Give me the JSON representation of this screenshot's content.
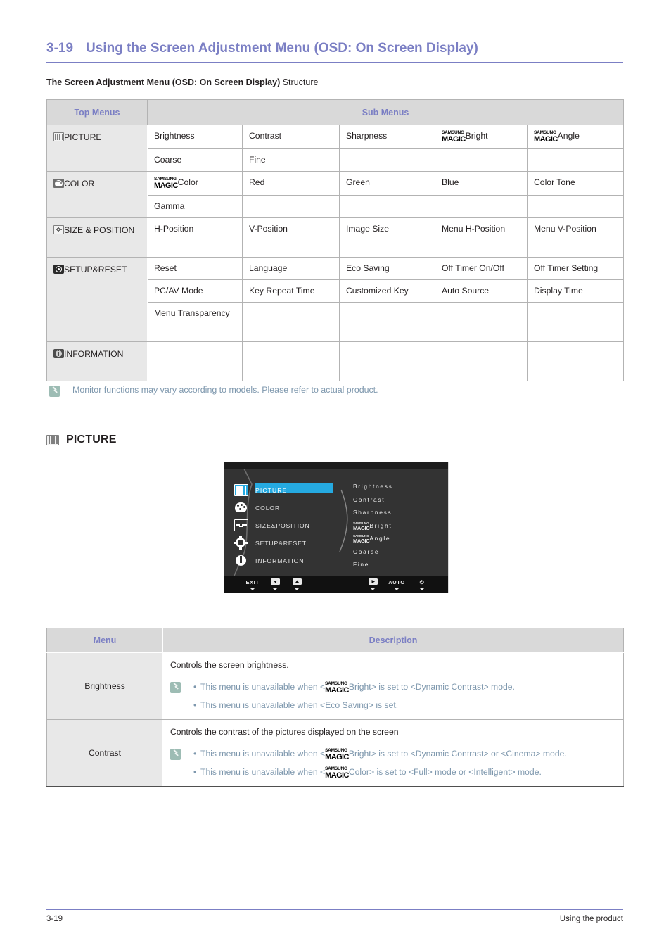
{
  "header": {
    "section_number": "3-19",
    "title": "Using the Screen Adjustment Menu (OSD: On Screen Display)",
    "accent_color": "#7b7fc4"
  },
  "subtitle": {
    "bold": "The Screen Adjustment Menu (OSD: On Screen Display)",
    "plain": " Structure"
  },
  "structure_table": {
    "headers": {
      "top_menus": "Top Menus",
      "sub_menus": "Sub Menus"
    },
    "rows": [
      {
        "top_label": "PICTURE",
        "icon": "picture-icon",
        "sub_rows": [
          [
            "Brightness",
            "Contrast",
            "Sharpness",
            "MAGIC:Bright",
            "MAGIC:Angle"
          ],
          [
            "Coarse",
            "Fine",
            "",
            "",
            ""
          ]
        ]
      },
      {
        "top_label": "COLOR",
        "icon": "color-palette-icon",
        "sub_rows": [
          [
            "MAGIC:Color",
            "Red",
            "Green",
            "Blue",
            "Color Tone"
          ],
          [
            "Gamma",
            "",
            "",
            "",
            ""
          ]
        ]
      },
      {
        "top_label": "SIZE & POSITION",
        "icon": "size-position-icon",
        "sub_rows": [
          [
            "H-Position",
            "V-Position",
            "Image Size",
            "Menu H-Position",
            "Menu V-Position"
          ]
        ]
      },
      {
        "top_label": "SETUP&RESET",
        "icon": "setup-reset-icon",
        "sub_rows": [
          [
            "Reset",
            "Language",
            "Eco Saving",
            "Off Timer On/Off",
            "Off Timer Setting"
          ],
          [
            "PC/AV Mode",
            "Key Repeat Time",
            "Customized Key",
            "Auto Source",
            "Display Time"
          ],
          [
            "Menu Transparency",
            "",
            "",
            "",
            ""
          ]
        ]
      },
      {
        "top_label": "INFORMATION",
        "icon": "information-icon",
        "sub_rows": [
          [
            "",
            "",
            "",
            "",
            ""
          ]
        ]
      }
    ]
  },
  "structure_note": "Monitor functions may vary according to models. Please refer to actual product.",
  "picture_section": {
    "heading": "PICTURE",
    "icon": "picture-icon"
  },
  "osd": {
    "left_menu": [
      {
        "label": "PICTURE",
        "icon": "picture-icon",
        "selected": true
      },
      {
        "label": "COLOR",
        "icon": "color-palette-icon",
        "selected": false
      },
      {
        "label": "SIZE&POSITION",
        "icon": "size-position-icon",
        "selected": false
      },
      {
        "label": "SETUP&RESET",
        "icon": "setup-reset-icon",
        "selected": false
      },
      {
        "label": "INFORMATION",
        "icon": "information-icon",
        "selected": false
      }
    ],
    "sub_menu": [
      {
        "label": "Brightness",
        "magic": false
      },
      {
        "label": "Contrast",
        "magic": false
      },
      {
        "label": "Sharpness",
        "magic": false
      },
      {
        "label": "Bright",
        "magic": true
      },
      {
        "label": "Angle",
        "magic": true
      },
      {
        "label": "Coarse",
        "magic": false
      },
      {
        "label": "Fine",
        "magic": false
      }
    ],
    "buttons": [
      {
        "label": "EXIT",
        "type": "text",
        "name": "exit-button"
      },
      {
        "label": "",
        "type": "down-box",
        "name": "down-button"
      },
      {
        "label": "",
        "type": "up-box",
        "name": "up-button"
      },
      {
        "label": "",
        "type": "enter-box",
        "name": "enter-button"
      },
      {
        "label": "AUTO",
        "type": "text",
        "name": "auto-button"
      },
      {
        "label": "⏻",
        "type": "power",
        "name": "power-button"
      }
    ],
    "highlight_color": "#25aae1"
  },
  "magic_logo": {
    "line1": "SAMSUNG",
    "line2": "MAGIC"
  },
  "description_table": {
    "headers": {
      "menu": "Menu",
      "description": "Description"
    },
    "rows": [
      {
        "menu": "Brightness",
        "lead": "Controls the screen brightness.",
        "bullets": [
          {
            "pre": "This menu is unavailable when <",
            "magic": true,
            "magic_suffix": "Bright",
            "post": "> is set to <Dynamic Contrast> mode."
          },
          {
            "pre": "This menu is unavailable when <Eco Saving> is set.",
            "magic": false,
            "magic_suffix": "",
            "post": ""
          }
        ]
      },
      {
        "menu": "Contrast",
        "lead": "Controls the contrast of the pictures displayed on the screen",
        "bullets": [
          {
            "pre": "This menu is unavailable when <",
            "magic": true,
            "magic_suffix": "Bright",
            "post": "> is set to <Dynamic Contrast> or <Cinema> mode."
          },
          {
            "pre": "This menu is unavailable when <",
            "magic": true,
            "magic_suffix": "Color",
            "post": "> is set to <Full> mode or <Intelligent> mode."
          }
        ]
      }
    ]
  },
  "footer": {
    "left": "3-19",
    "right": "Using the product"
  }
}
